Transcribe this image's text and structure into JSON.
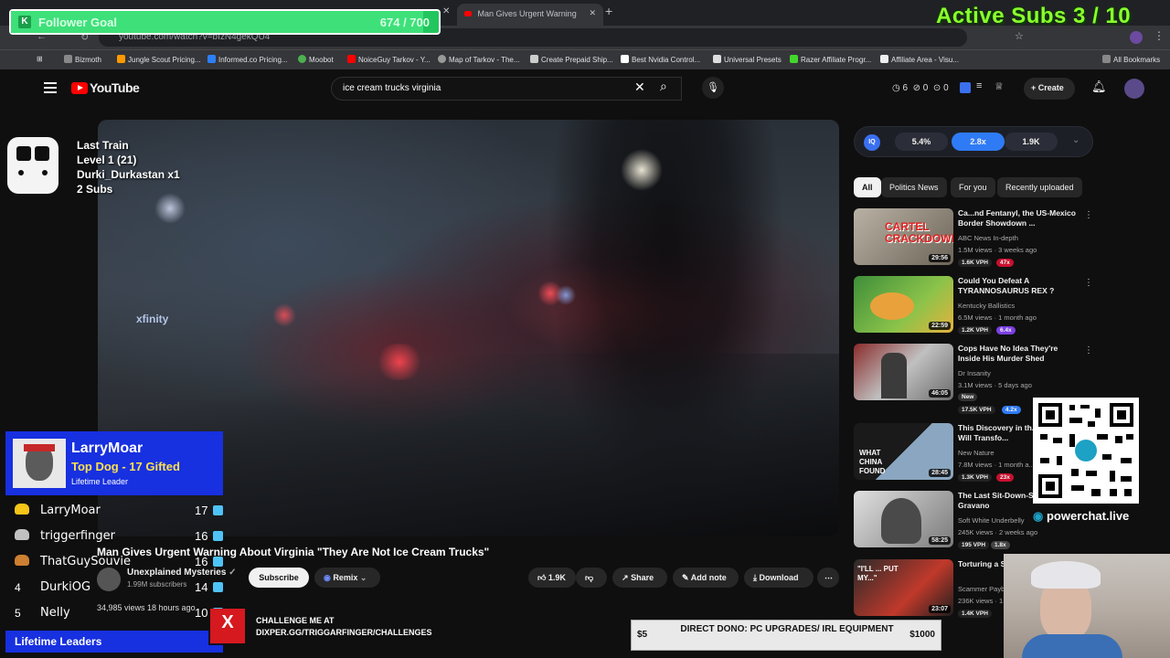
{
  "browser": {
    "tabs": [
      {
        "title": "Man Gives Urgent Warning"
      }
    ],
    "url": "youtube.com/watch?v=bIzN4gekQU4",
    "bookmarks": [
      "Bizmoth",
      "Jungle Scout Pricing...",
      "Informed.co Pricing...",
      "Moobot",
      "NoiceGuy Tarkov - Y...",
      "Map of Tarkov - The...",
      "Create Prepaid Ship...",
      "Best Nvidia Control...",
      "Universal Presets",
      "Razer Affiliate Progr...",
      "Affiliate Area - Visu..."
    ],
    "all_bookmarks": "All Bookmarks"
  },
  "youtube": {
    "logo": "YouTube",
    "search_value": "ice cream trucks virginia",
    "create_label": "Create",
    "header_counts": [
      "6",
      "0",
      "0"
    ],
    "video": {
      "overlay_text": "xfinity",
      "title": "Man Gives Urgent Warning About Virginia \"They Are Not Ice Cream Trucks\"",
      "channel": "Unexplained Mysteries",
      "subscribers": "1.99M subscribers",
      "subscribe_label": "Subscribe",
      "remix_label": "Remix",
      "likes": "1.9K",
      "share_label": "Share",
      "add_note_label": "Add note",
      "download_label": "Download",
      "meta": "34,985 views  18 hours ago"
    },
    "iq_bar": {
      "logo": "IQ",
      "stats": [
        "5.4%",
        "2.8x",
        "1.9K"
      ]
    },
    "chips": [
      "All",
      "Politics News",
      "For you",
      "Recently uploaded"
    ],
    "recommendations": [
      {
        "title": "Ca...nd Fentanyl, the US-Mexico Border Showdown ...",
        "channel": "ABC News In-depth",
        "views": "1.5M views · 3 weeks ago",
        "duration": "29:56",
        "vph": "1.6K VPH",
        "mult": "47x",
        "thumb_text": "CARTEL CRACKDOWN"
      },
      {
        "title": "Could You Defeat A TYRANNOSAURUS REX ?",
        "channel": "Kentucky Ballistics",
        "views": "6.5M views · 1 month ago",
        "duration": "22:59",
        "vph": "1.2K VPH",
        "mult": "6.4x",
        "thumb_text": ""
      },
      {
        "title": "Cops Have No Idea They're Inside His Murder Shed",
        "channel": "Dr Insanity",
        "views": "3.1M views · 5 days ago",
        "duration": "46:05",
        "vph": "17.5K VPH",
        "mult": "4.2x",
        "thumb_text": "",
        "new": "New"
      },
      {
        "title": "This Discovery in th... Trench Will Transfo...",
        "channel": "New Nature",
        "views": "7.8M views · 1 month a...",
        "duration": "28:45",
        "vph": "1.3K VPH",
        "mult": "23x",
        "thumb_text": "WHAT CHINA FOUND"
      },
      {
        "title": "The Last Sit-Down-S... Bull\" Gravano",
        "channel": "Soft White Underbelly",
        "views": "245K views · 2 weeks ago",
        "duration": "58:25",
        "vph": "195 VPH",
        "mult": "1.8x",
        "thumb_text": ""
      },
      {
        "title": "Torturing a Sc... Give Up",
        "channel": "Scammer Payba...",
        "views": "236K views · 1 ...",
        "duration": "23:07",
        "vph": "1.4K VPH",
        "mult": "",
        "thumb_text": "\"I'LL ... PUT MY...\""
      }
    ]
  },
  "overlay": {
    "follower_goal": {
      "label": "Follower Goal",
      "count": "674 / 700",
      "progress": 0.963
    },
    "active_subs": "Active Subs 3 / 10",
    "train": {
      "line1": "Last Train",
      "line2": "Level 1 (21)",
      "line3": "Durki_Durkastan x1",
      "line4": "2 Subs"
    },
    "leader": {
      "name": "LarryMoar",
      "title": "Top Dog - 17 Gifted",
      "subtitle": "Lifetime Leader"
    },
    "leaderboard": [
      {
        "rank": "",
        "name": "LarryMoar",
        "count": "17",
        "medal": "#f5c518"
      },
      {
        "rank": "",
        "name": "triggerfinger",
        "count": "16",
        "medal": "#c0c0c0"
      },
      {
        "rank": "",
        "name": "ThatGuySouvie",
        "count": "16",
        "medal": "#cd7f32"
      },
      {
        "rank": "4",
        "name": "DurkiOG",
        "count": "14",
        "medal": ""
      },
      {
        "rank": "5",
        "name": "Nelly",
        "count": "10",
        "medal": ""
      }
    ],
    "leaderboard_footer": "Lifetime Leaders",
    "challenge": {
      "line1": "CHALLENGE ME AT",
      "line2": "DIXPER.GG/TRIGGARFINGER/CHALLENGES",
      "logo": "X"
    },
    "dono": {
      "min": "$5",
      "max": "$1000",
      "text": "DIRECT DONO: PC UPGRADES/ IRL EQUIPMENT"
    },
    "qr_label": "powerchat.live"
  }
}
